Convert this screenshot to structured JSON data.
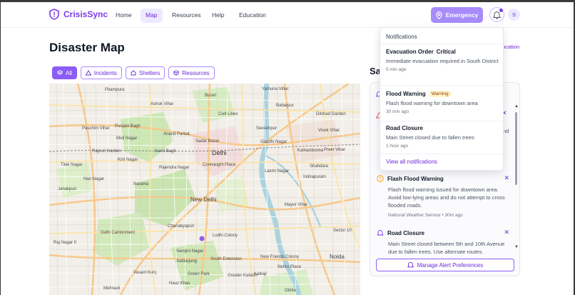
{
  "brand": {
    "name": "CrisisSync"
  },
  "nav": {
    "links": [
      "Home",
      "Map",
      "Resources",
      "Help",
      "Education"
    ],
    "active": "Map",
    "emergency_label": "Emergency",
    "avatar_initial": "S"
  },
  "page": {
    "title": "Disaster Map",
    "filters": [
      "All",
      "Incidents",
      "Shelters",
      "Resources"
    ],
    "active_filter": "All"
  },
  "map": {
    "labels": [
      "Pitampura",
      "Yamuna Vihar",
      "Burari",
      "Ashok Vihar",
      "Civil Lines",
      "Babarpur",
      "Dilshad Garden",
      "Paschim Vihar",
      "Punjabi Bagh",
      "Karol Bagh",
      "Sadar Bazar",
      "Delhi",
      "Gandhi Nagar",
      "Preet Vihar",
      "Rajendra Nagar",
      "Connaught Place",
      "Laxmi Nagar",
      "New Delhi",
      "Mayur Vihar",
      "Janakpuri",
      "Naraina",
      "Delhi Cantonment",
      "Chanakyapuri",
      "Lodhi Colony",
      "Sarojini Nagar",
      "Sector 10",
      "Noida",
      "Safdarjung",
      "Green Park",
      "South Extension",
      "New Friends Colony",
      "Greater Kailash",
      "Hauz Khas",
      "Mehrauli",
      "Okhla",
      "Raj Nagar II",
      "Rajouri Garden",
      "Kirti Nagar",
      "Tilak Nagar",
      "Hari Nagar",
      "Moti Nagar",
      "Karkardooma",
      "Anand Parbat",
      "Vivek Vihar",
      "Shahdara",
      "Seelampur",
      "Indirapuram",
      "Kalkaji",
      "Vasant Kunj",
      "Nehru Place"
    ]
  },
  "side": {
    "title_visible": "Sa",
    "location_link_visible": "ocation",
    "alerts": [
      {
        "title": "Flash Flood Warning",
        "body": "Flash flood warning issued for downtown area. Avoid low-lying areas and do not attempt to cross flooded roads.",
        "source": "National Weather Service",
        "time": "30m ago",
        "icon": "alert-circle-icon",
        "color": "#f59e0b"
      },
      {
        "title": "Road Closure",
        "body": "Main Street closed between 5th and 10th Avenue due to fallen trees. Use alternate routes.",
        "icon": "bell-icon",
        "color": "#7c3aed"
      }
    ],
    "partial_text": "nd",
    "manage_label": "Manage Alert Preferences"
  },
  "notifications": {
    "title": "Notifications",
    "items": [
      {
        "title": "Evacuation Order",
        "badge": "Critical",
        "body": "Immediate evacuation required in South District",
        "time": "5 min ago"
      },
      {
        "title": "Flood Warning",
        "badge": "Warning",
        "body": "Flash flood warning for downtown area",
        "time": "30 min ago"
      },
      {
        "title": "Road Closure",
        "badge": "",
        "body": "Main Street closed due to fallen trees",
        "time": "1 hour ago"
      }
    ],
    "view_all": "View all notifications"
  },
  "colors": {
    "accent": "#7c3aed",
    "accent_light": "#a78bfa",
    "warning": "#f59e0b"
  }
}
